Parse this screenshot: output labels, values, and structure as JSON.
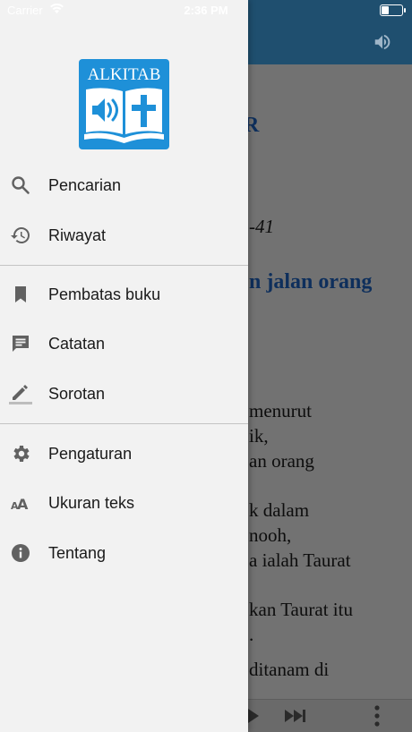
{
  "status_bar": {
    "carrier": "Carrier",
    "time": "2:36 PM"
  },
  "app": {
    "logo_text": "ALKITAB"
  },
  "menu": {
    "group1": [
      {
        "label": "Pencarian",
        "icon": "search-icon"
      },
      {
        "label": "Riwayat",
        "icon": "history-icon"
      }
    ],
    "group2": [
      {
        "label": "Pembatas buku",
        "icon": "bookmark-icon"
      },
      {
        "label": "Catatan",
        "icon": "note-icon"
      },
      {
        "label": "Sorotan",
        "icon": "highlight-pen-icon"
      }
    ],
    "group3": [
      {
        "label": "Pengaturan",
        "icon": "gear-icon"
      },
      {
        "label": "Ukuran teks",
        "icon": "text-size-icon"
      },
      {
        "label": "Tentang",
        "icon": "info-icon"
      }
    ]
  },
  "background_text": {
    "line1": "R",
    "line2": "-41",
    "line3": "n jalan orang",
    "line4": "menurut",
    "line5": "ik,",
    "line6": "an orang",
    "line7": "k dalam",
    "line8": "nooh,",
    "line9": "a ialah Taurat",
    "line10": "kan Taurat itu",
    "line11": ".",
    "line12": "ditanam di"
  },
  "colors": {
    "drawer_bg": "#f2f2f2",
    "logo_blue": "#1e90d8",
    "header_bg": "#1f4f6f",
    "dim_overlay": "#727272"
  }
}
